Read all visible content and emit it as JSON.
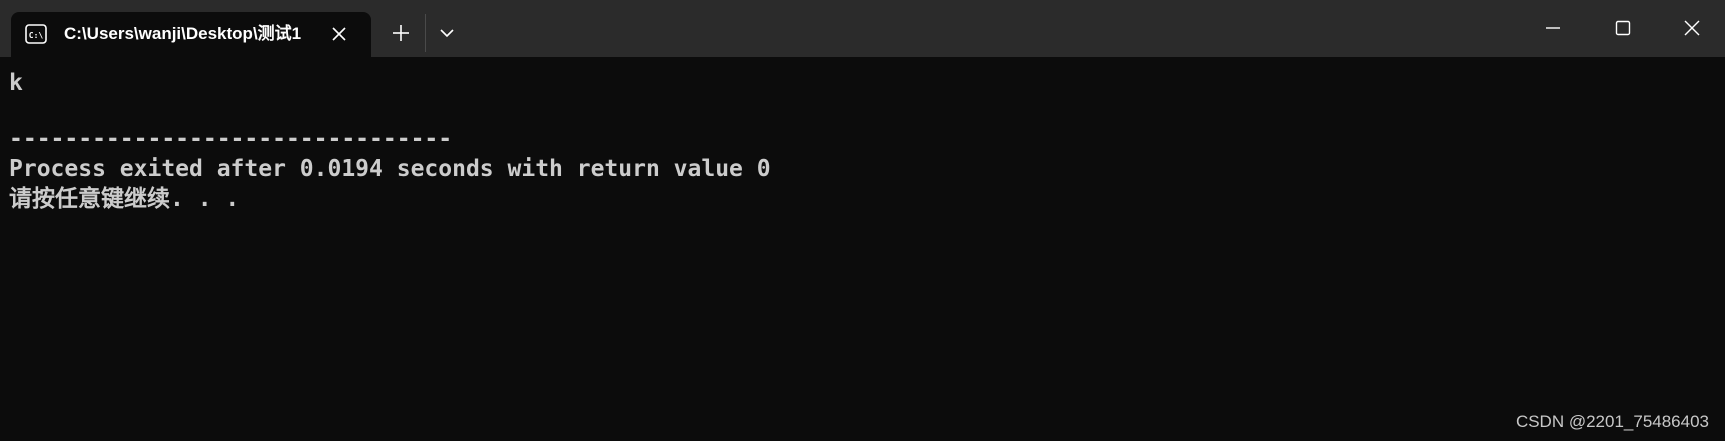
{
  "window": {
    "tab_title": "C:\\Users\\wanji\\Desktop\\测试1",
    "tab_icon": "console-icon",
    "background": "#0c0c0c",
    "titlebar_color": "#2b2b2b",
    "text_color": "#cccccc"
  },
  "titlebar": {
    "new_tab_icon": "plus-icon",
    "dropdown_icon": "chevron-down-icon",
    "minimize_icon": "minimize-icon",
    "maximize_icon": "maximize-icon",
    "close_icon": "close-icon"
  },
  "console": {
    "lines": [
      "k",
      "--------------------------------",
      "Process exited after 0.0194 seconds with return value 0",
      "请按任意键继续. . ."
    ]
  },
  "watermark": "CSDN @2201_75486403"
}
